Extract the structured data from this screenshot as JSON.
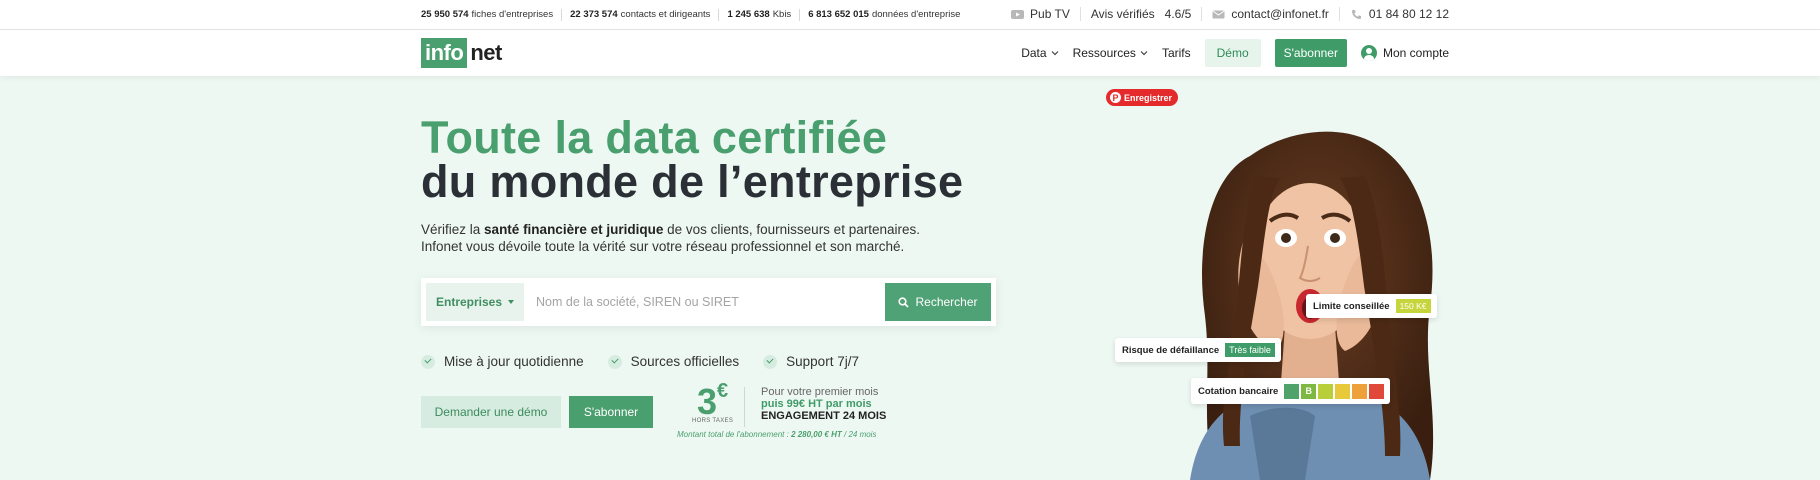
{
  "topbar": {
    "stats": [
      {
        "value": "25 950 574",
        "label": "fiches d'entreprises"
      },
      {
        "value": "22 373 574",
        "label": "contacts et dirigeants"
      },
      {
        "value": "1 245 638",
        "label": "Kbis"
      },
      {
        "value": "6 813 652 015",
        "label": "données d'entreprise"
      }
    ],
    "pub_tv": "Pub TV",
    "reviews_label": "Avis vérifiés",
    "reviews_score": "4.6/5",
    "email": "contact@infonet.fr",
    "phone": "01 84 80 12 12"
  },
  "nav": {
    "logo_info": "info",
    "logo_net": "net",
    "items": [
      {
        "label": "Data"
      },
      {
        "label": "Ressources"
      }
    ],
    "tarifs": "Tarifs",
    "demo": "Démo",
    "subscribe": "S'abonner",
    "account": "Mon compte"
  },
  "hero": {
    "title_line1": "Toute la data certifiée",
    "title_line2": "du monde de l’entreprise",
    "lead_prefix": "Vérifiez la",
    "lead_bold": "santé financière et juridique",
    "lead_suffix": "de vos clients, fournisseurs et partenaires.",
    "lead_line2": "Infonet vous dévoile toute la vérité sur votre réseau professionnel et son marché.",
    "search": {
      "select_value": "Entreprises",
      "placeholder": "Nom de la société, SIREN ou SIRET",
      "button": "Rechercher"
    },
    "features": [
      "Mise à jour quotidienne",
      "Sources officielles",
      "Support 7j/7"
    ],
    "btn_demo": "Demander une démo",
    "btn_subscribe": "S'abonner",
    "price": {
      "amount": "3",
      "currency": "€",
      "tax_note": "HORS TAXES",
      "line1": "Pour votre premier mois",
      "line2": "puis 99€ HT par mois",
      "line3": "ENGAGEMENT 24 MOIS",
      "total_prefix": "Montant total de l'abonnement :",
      "total_value": "2 280,00 € HT",
      "total_suffix": "/ 24 mois"
    },
    "pinterest": "Enregistrer",
    "tags": {
      "limit_label": "Limite conseillée",
      "limit_value": "150 K€",
      "risk_label": "Risque de défaillance",
      "risk_value": "Très faible",
      "cotation_label": "Cotation bancaire",
      "cotation_active": "B",
      "cotation_colors": [
        "#4fa36a",
        "#7cb842",
        "#b9cf3a",
        "#e8c93a",
        "#eea03a",
        "#e0483a"
      ]
    }
  },
  "colors": {
    "brand_green": "#4a9f6e",
    "hero_bg": "#eef8f3",
    "dark_text": "#2b3036"
  }
}
